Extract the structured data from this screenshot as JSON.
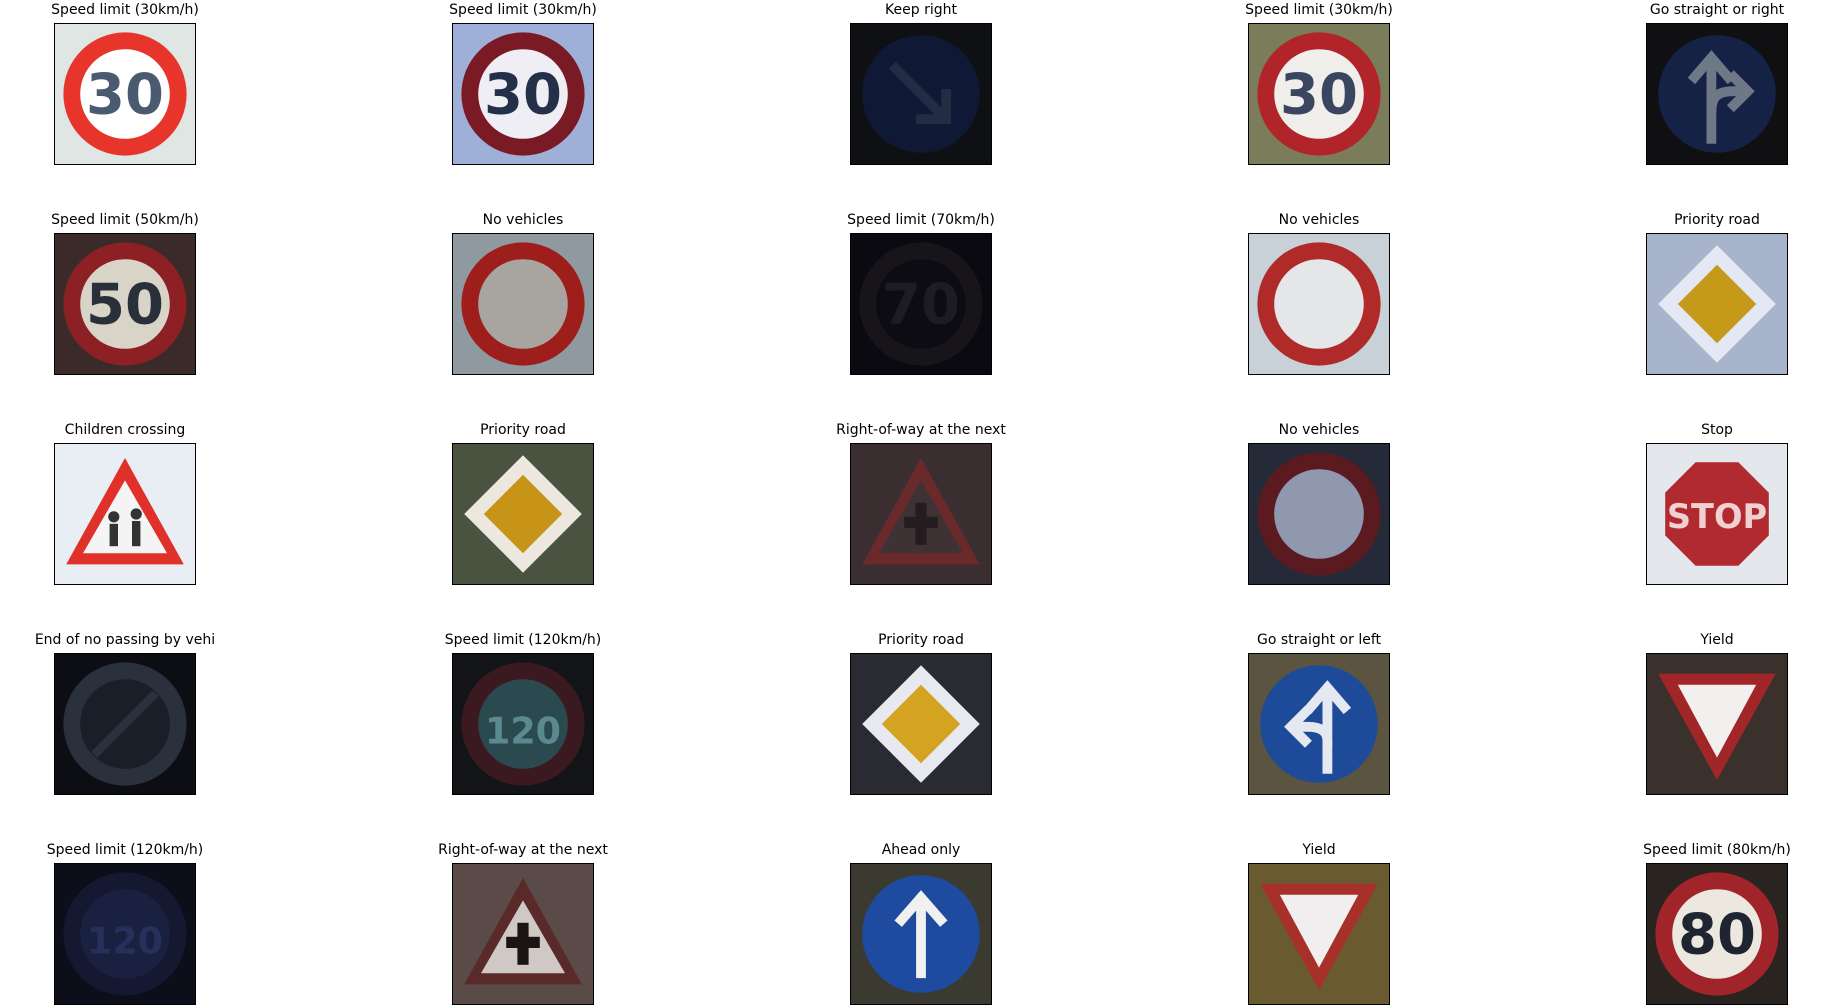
{
  "images": [
    {
      "title": "Speed limit (30km/h)",
      "sign": "speed",
      "text": "30",
      "bg": "#dfe6e4",
      "ring": "#e8352b",
      "face": "#ffffff",
      "ink": "#4a5a70",
      "brightness": 1.0
    },
    {
      "title": "Speed limit (30km/h)",
      "sign": "speed",
      "text": "30",
      "bg": "#9fb0d8",
      "ring": "#7a1a24",
      "face": "#eeeef4",
      "ink": "#24304a",
      "brightness": 1.0
    },
    {
      "title": "Keep right",
      "sign": "blue-arrow",
      "arrow": "down-right",
      "bg": "#1a1c22",
      "blue": "#1a2a5a",
      "ink": "#3a4a70",
      "brightness": 0.6
    },
    {
      "title": "Speed limit (30km/h)",
      "sign": "speed",
      "text": "30",
      "bg": "#7b7d5a",
      "ring": "#b0242a",
      "face": "#f0eeea",
      "ink": "#3a4660",
      "brightness": 1.0
    },
    {
      "title": "Go straight or right",
      "sign": "blue-arrow",
      "arrow": "straight-right",
      "bg": "#141418",
      "blue": "#1c2a58",
      "ink": "#8a96a8",
      "brightness": 0.8
    },
    {
      "title": "Speed limit (50km/h)",
      "sign": "speed",
      "text": "50",
      "bg": "#3a2a28",
      "ring": "#8c2024",
      "face": "#d8d4c8",
      "ink": "#2a303a",
      "brightness": 1.0
    },
    {
      "title": "No vehicles",
      "sign": "ring",
      "bg": "#8e9aa0",
      "ring": "#9e1e1c",
      "face": "#a8a4a0",
      "brightness": 1.0
    },
    {
      "title": "Speed limit (70km/h)",
      "sign": "speed",
      "text": "70",
      "bg": "#0a0a10",
      "ring": "#17141a",
      "face": "#0c0c12",
      "ink": "#1c1c24",
      "brightness": 1.0
    },
    {
      "title": "No vehicles",
      "sign": "ring",
      "bg": "#c8d0d8",
      "ring": "#b02a2a",
      "face": "#e4e6e8",
      "brightness": 1.0
    },
    {
      "title": "Priority road",
      "sign": "diamond",
      "bg": "#a8b4cc",
      "edge": "#e4e8f4",
      "fill": "#c49a18",
      "brightness": 1.0
    },
    {
      "title": "Children crossing",
      "sign": "triangle-kids",
      "bg": "#e8eef4",
      "ring": "#e0302a",
      "face": "#f4f4f4",
      "ink": "#333333",
      "brightness": 1.0
    },
    {
      "title": "Priority road",
      "sign": "diamond",
      "bg": "#4a5240",
      "edge": "#ece8e0",
      "fill": "#c89418",
      "brightness": 1.0
    },
    {
      "title": "Right-of-way at the next",
      "sign": "triangle-cross",
      "bg": "#3a2e30",
      "ring": "#6a2a2c",
      "face": "#3e3234",
      "ink": "#241c1e",
      "brightness": 1.0
    },
    {
      "title": "No vehicles",
      "sign": "ring",
      "bg": "#242a38",
      "ring": "#5a1a20",
      "face": "#9098b0",
      "brightness": 1.0
    },
    {
      "title": "Stop",
      "sign": "stop",
      "text": "STOP",
      "bg": "#e4e8ec",
      "fill": "#b02a30",
      "ink": "#f0d0d0",
      "brightness": 1.0
    },
    {
      "title": "End of no passing by vehi",
      "sign": "end-ring",
      "bg": "#0c0e14",
      "ring": "#2a303c",
      "face": "#1a1e28",
      "brightness": 1.0
    },
    {
      "title": "Speed limit (120km/h)",
      "sign": "speed",
      "text": "120",
      "bg": "#121418",
      "ring": "#3a1a20",
      "face": "#2a4a50",
      "ink": "#5a8a90",
      "brightness": 1.0
    },
    {
      "title": "Priority road",
      "sign": "diamond",
      "bg": "#2a2a32",
      "edge": "#e8e8f0",
      "fill": "#d4a420",
      "brightness": 1.0
    },
    {
      "title": "Go straight or left",
      "sign": "blue-arrow",
      "arrow": "straight-left",
      "bg": "#5a5440",
      "blue": "#1e4a9a",
      "ink": "#e4e8f0",
      "brightness": 1.0
    },
    {
      "title": "Yield",
      "sign": "yield",
      "bg": "#3a302c",
      "ring": "#a02628",
      "face": "#f2f0ee",
      "brightness": 1.0
    },
    {
      "title": "Speed limit (120km/h)",
      "sign": "speed",
      "text": "120",
      "bg": "#0c0e1a",
      "ring": "#141830",
      "face": "#1a2040",
      "ink": "#26305a",
      "brightness": 1.0
    },
    {
      "title": "Right-of-way at the next",
      "sign": "triangle-cross",
      "bg": "#5a4a48",
      "ring": "#5a2a2a",
      "face": "#cfc8c4",
      "ink": "#1a1414",
      "brightness": 1.0
    },
    {
      "title": "Ahead only",
      "sign": "blue-arrow",
      "arrow": "up",
      "bg": "#3a3a30",
      "blue": "#1e4aa0",
      "ink": "#f0f0f0",
      "brightness": 1.0
    },
    {
      "title": "Yield",
      "sign": "yield",
      "bg": "#6a5a30",
      "ring": "#a8302a",
      "face": "#f0eeee",
      "brightness": 1.0
    },
    {
      "title": "Speed limit (80km/h)",
      "sign": "speed",
      "text": "80",
      "bg": "#2a2420",
      "ring": "#a0242a",
      "face": "#ece8e0",
      "ink": "#1e2430",
      "brightness": 1.0
    }
  ]
}
